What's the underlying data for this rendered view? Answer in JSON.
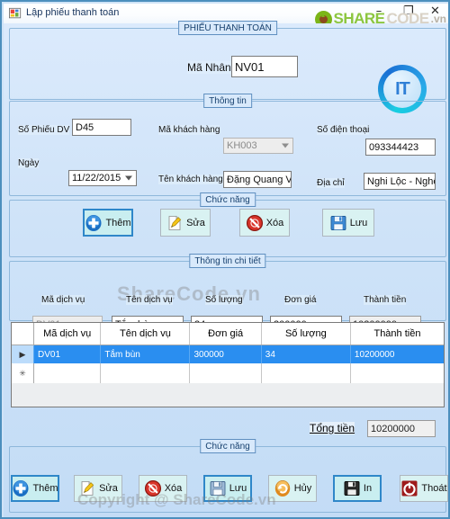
{
  "window": {
    "title": "Lập phiếu thanh toán",
    "icon": "form-icon",
    "controls": {
      "minimize": "–",
      "maximize": "❐",
      "close": "✕"
    }
  },
  "branding": {
    "watermark_share": "SHARE",
    "watermark_code": "CODE",
    "watermark_vn": ".vn",
    "logo_text": "IT",
    "detail_watermark": "ShareCode.vn",
    "bottom_watermark": "Copyright @ ShareCode.vn"
  },
  "header": {
    "legend": "PHIẾU THANH TOÁN",
    "employee_label": "Mã Nhân Viên",
    "employee_value": "NV01"
  },
  "info": {
    "legend": "Thông tin",
    "fields": [
      {
        "label": "Số Phiếu DV",
        "value": "D45"
      },
      {
        "label": "Ngày",
        "value": "11/22/2015"
      },
      {
        "label": "Mã khách hàng",
        "value": "KH003"
      },
      {
        "label": "Tên khách hàng",
        "value": "Đặng Quang Vinh"
      },
      {
        "label": "Số điện thoại",
        "value": "093344423"
      },
      {
        "label": "Địa chỉ",
        "value": "Nghi Lộc - Nghệ An"
      }
    ]
  },
  "actions_top": {
    "legend": "Chức năng",
    "buttons": [
      {
        "label": "Thêm",
        "icon": "add-icon"
      },
      {
        "label": "Sửa",
        "icon": "edit-icon"
      },
      {
        "label": "Xóa",
        "icon": "delete-icon"
      },
      {
        "label": "Lưu",
        "icon": "save-icon"
      }
    ]
  },
  "detail": {
    "legend": "Thông tin chi tiết",
    "fields": [
      {
        "label": "Mã dịch vụ",
        "value": "DV01"
      },
      {
        "label": "Tên dịch vụ",
        "value": "Tắm bùn"
      },
      {
        "label": "Số lượng",
        "value": "34"
      },
      {
        "label": "Đơn giá",
        "value": "300000"
      },
      {
        "label": "Thành tiền",
        "value": "10200000"
      }
    ]
  },
  "grid": {
    "columns": [
      "Mã dịch vụ",
      "Tên dịch vụ",
      "Đơn giá",
      "Số lượng",
      "Thành tiền"
    ],
    "rows": [
      {
        "selector": "▶",
        "cells": [
          "DV01",
          "Tắm bùn",
          "300000",
          "34",
          "10200000"
        ]
      }
    ],
    "new_row_selector": "✳"
  },
  "total": {
    "label": "Tổng tiền",
    "value": "10200000"
  },
  "actions_bottom": {
    "legend": "Chức năng",
    "buttons": [
      {
        "label": "Thêm",
        "icon": "add-icon"
      },
      {
        "label": "Sửa",
        "icon": "edit-icon"
      },
      {
        "label": "Xóa",
        "icon": "delete-icon"
      },
      {
        "label": "Lưu",
        "icon": "save-icon"
      },
      {
        "label": "Hủy",
        "icon": "cancel-icon"
      },
      {
        "label": "In",
        "icon": "print-icon"
      },
      {
        "label": "Thoát",
        "icon": "exit-icon"
      }
    ]
  },
  "colors": {
    "accent": "#2a8ef0",
    "form_bg": "#cfe3f7",
    "button_bg": "#d9f2f2",
    "border": "#8fb8db"
  }
}
